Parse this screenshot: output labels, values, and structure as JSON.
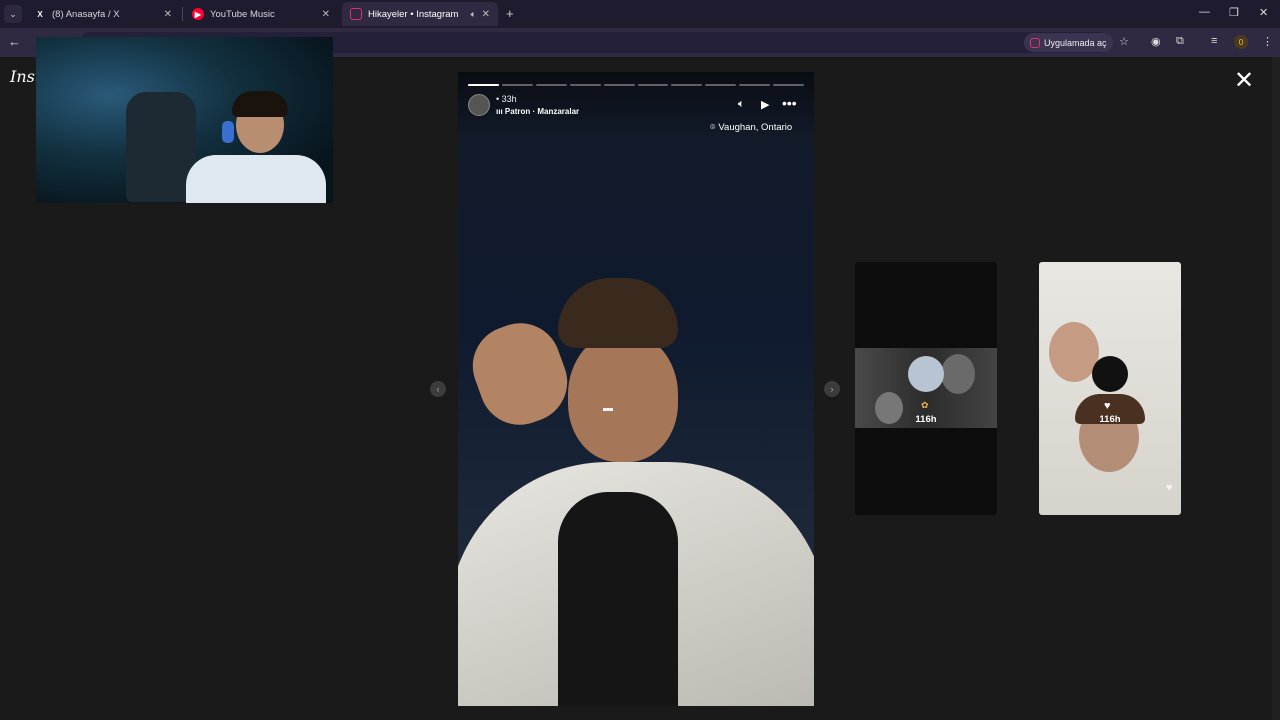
{
  "browser": {
    "tabs": [
      {
        "label": "(8) Anasayfa / X",
        "favicon": "x-logo"
      },
      {
        "label": "YouTube Music",
        "favicon": "youtube-music-logo"
      },
      {
        "label": "Hikayeler • Instagram",
        "favicon": "instagram-logo",
        "active": true
      }
    ],
    "open_in_app": "Uygulamada aç",
    "profile_count": "0"
  },
  "page": {
    "logo": "Inst"
  },
  "story": {
    "time_ago": "33h",
    "music": "Patron · Manzaralar",
    "location": "Vaughan, Ontario",
    "progress_segments": 10,
    "current_segment": 1,
    "current_progress": 1.0
  },
  "previews": [
    {
      "label": "116h"
    },
    {
      "label": "116h"
    }
  ],
  "colors": {
    "tab_bar": "#1f1b2e",
    "toolbar": "#2f2a42",
    "page_bg": "#1a1a1a",
    "instagram_accent": "#e1306c"
  }
}
